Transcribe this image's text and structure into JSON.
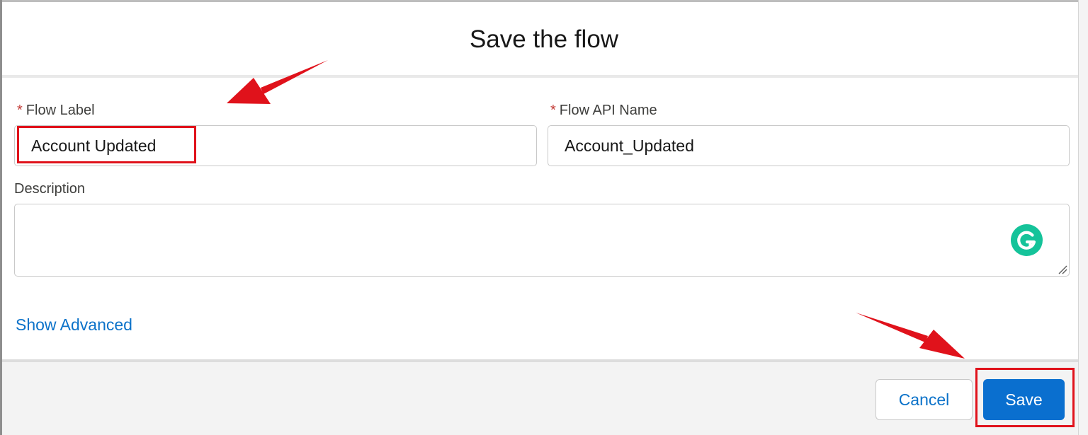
{
  "dialog": {
    "title": "Save the flow"
  },
  "form": {
    "flow_label": {
      "label": "Flow Label",
      "required_marker": "*",
      "value": "Account Updated"
    },
    "flow_api_name": {
      "label": "Flow API Name",
      "required_marker": "*",
      "value": "Account_Updated"
    },
    "description": {
      "label": "Description",
      "value": ""
    },
    "show_advanced_label": "Show Advanced"
  },
  "footer": {
    "cancel_label": "Cancel",
    "save_label": "Save"
  },
  "icons": {
    "grammarly": "grammarly-icon",
    "resize": "resize-grip-icon"
  },
  "colors": {
    "accent": "#0a6fcf",
    "link": "#0b72c9",
    "required": "#c23934",
    "annotation": "#e0121b",
    "grammarly": "#15c39a",
    "footer_bg": "#f3f3f3"
  }
}
